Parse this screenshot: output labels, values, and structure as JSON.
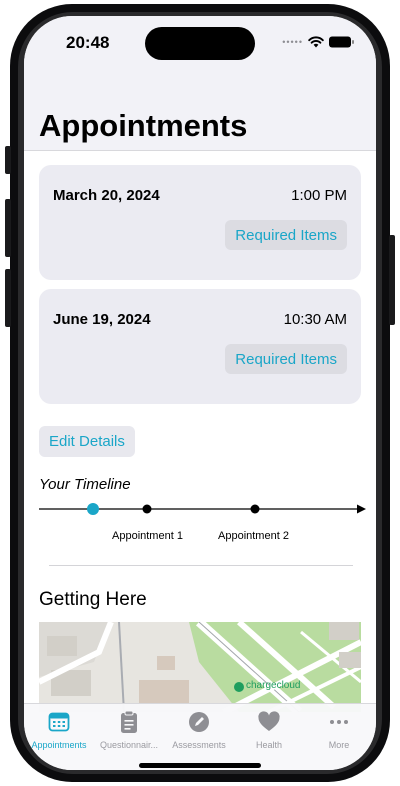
{
  "status_bar": {
    "time": "20:48"
  },
  "header": {
    "title": "Appointments"
  },
  "appointments": [
    {
      "date": "March 20, 2024",
      "time": "1:00 PM",
      "button": "Required Items"
    },
    {
      "date": "June 19, 2024",
      "time": "10:30 AM",
      "button": "Required Items"
    }
  ],
  "edit_button": "Edit Details",
  "timeline": {
    "title": "Your Timeline",
    "labels": [
      "Appointment 1",
      "Appointment 2"
    ]
  },
  "getting_here": {
    "title": "Getting Here",
    "map_label": "chargecloud"
  },
  "tabs": [
    {
      "label": "Appointments",
      "icon": "calendar-icon",
      "active": true
    },
    {
      "label": "Questionnair...",
      "icon": "clipboard-icon",
      "active": false
    },
    {
      "label": "Assessments",
      "icon": "pencil-circle-icon",
      "active": false
    },
    {
      "label": "Health",
      "icon": "heart-icon",
      "active": false
    },
    {
      "label": "More",
      "icon": "ellipsis-icon",
      "active": false
    }
  ],
  "colors": {
    "accent": "#1aa6c8",
    "card_background": "#ebebf2",
    "header_background": "#f2f2f7",
    "inactive_tab": "#9a9aa0",
    "current_marker": "#1aa6c8"
  }
}
